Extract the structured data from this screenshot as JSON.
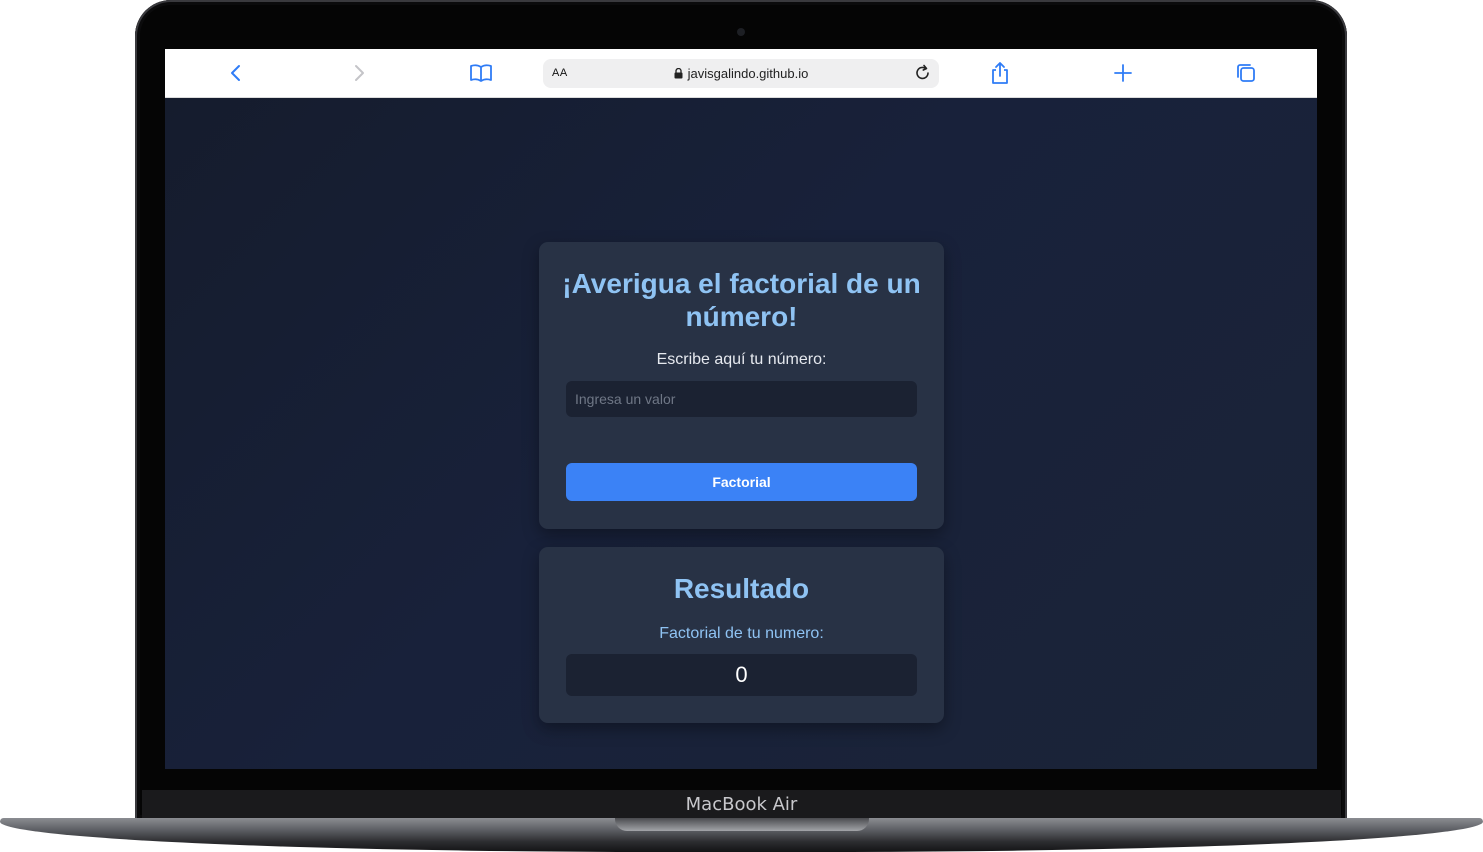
{
  "device": {
    "brand_label": "MacBook Air"
  },
  "browser": {
    "text_size_label": "AA",
    "url": "javisgalindo.github.io",
    "icons": {
      "back": "chevron-left-icon",
      "forward": "chevron-right-icon",
      "bookmarks": "book-icon",
      "lock": "lock-icon",
      "reload": "reload-icon",
      "share": "share-icon",
      "new_tab": "plus-icon",
      "tabs": "tabs-icon"
    },
    "accent_color": "#3b82f6"
  },
  "page": {
    "background_color": "#151c2d",
    "input_card": {
      "title": "¡Averigua el factorial de un número!",
      "prompt": "Escribe aquí tu número:",
      "input_placeholder": "Ingresa un valor",
      "input_value": "",
      "button_label": "Factorial",
      "button_color": "#3b82f6",
      "title_color": "#8fc3f3"
    },
    "result_card": {
      "title": "Resultado",
      "label": "Factorial de tu numero:",
      "value": "0"
    }
  }
}
